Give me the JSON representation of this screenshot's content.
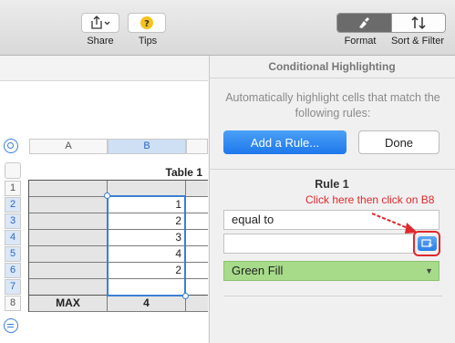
{
  "toolbar": {
    "share_label": "Share",
    "tips_label": "Tips",
    "format_label": "Format",
    "sort_filter_label": "Sort & Filter"
  },
  "spreadsheet": {
    "column_headers": [
      "A",
      "B"
    ],
    "row_headers": [
      "1",
      "2",
      "3",
      "4",
      "5",
      "6",
      "7",
      "8"
    ],
    "table_title": "Table 1",
    "column_b_values": [
      "1",
      "2",
      "3",
      "4",
      "2",
      ""
    ],
    "footer_label": "MAX",
    "footer_value": "4"
  },
  "panel": {
    "title": "Conditional Highlighting",
    "description": "Automatically highlight cells that match the following rules:",
    "add_rule_label": "Add a Rule...",
    "done_label": "Done",
    "rule_title": "Rule 1",
    "annotation": "Click here then click on B8",
    "condition_value": "equal to",
    "value_field": "",
    "style_value": "Green Fill"
  },
  "colors": {
    "accent": "#2a82f0",
    "annotation": "#e0282d",
    "green_fill": "#a7db8a",
    "selection": "#3b7fd4"
  }
}
